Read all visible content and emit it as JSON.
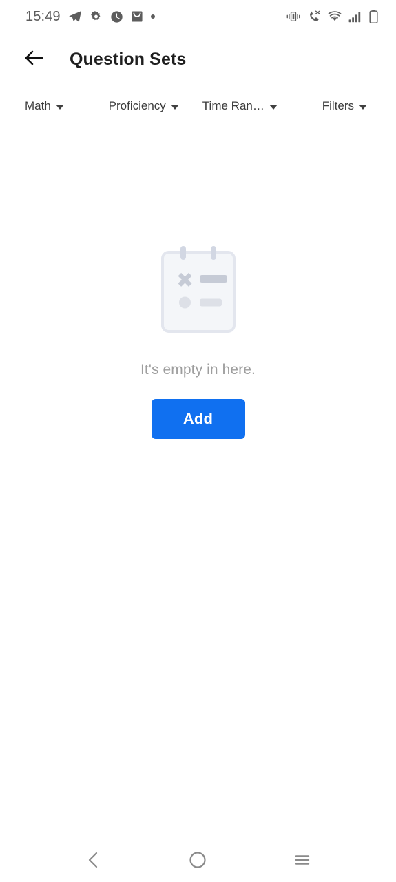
{
  "statusbar": {
    "time": "15:49",
    "left_icons": [
      {
        "name": "telegram-icon"
      },
      {
        "name": "gear-icon"
      },
      {
        "name": "clock-icon"
      },
      {
        "name": "inbox-icon"
      },
      {
        "name": "dot-indicator-icon"
      }
    ],
    "right_icons": [
      {
        "name": "vibrate-mode-icon"
      },
      {
        "name": "missed-call-icon"
      },
      {
        "name": "wifi-icon"
      },
      {
        "name": "cellular-signal-icon"
      },
      {
        "name": "battery-icon"
      }
    ],
    "colors": {
      "icon": "#5d5d5d",
      "text": "#5b5b5b"
    }
  },
  "appbar": {
    "back_icon": "arrow-left-icon",
    "title": "Question Sets",
    "title_color": "#1f1f1f"
  },
  "filters": [
    {
      "id": "subject",
      "label": "Math",
      "caret": "chevron-down-icon"
    },
    {
      "id": "proficiency",
      "label": "Proficiency",
      "caret": "chevron-down-icon"
    },
    {
      "id": "time-range",
      "label": "Time Ran…",
      "caret": "chevron-down-icon"
    },
    {
      "id": "filters",
      "label": "Filters",
      "caret": "chevron-down-icon"
    }
  ],
  "empty_state": {
    "illustration": "empty-clipboard-illustration",
    "message": "It's empty in here.",
    "message_color": "#9e9e9e",
    "action_label": "Add",
    "action_color": "#1070f0",
    "action_text_color": "#ffffff",
    "illustration_colors": {
      "card_fill": "#f5f6f8",
      "card_border": "#e2e5ed",
      "ring": "#d3d8e4",
      "mark_dark": "#c6cbd6",
      "mark_light": "#dcdfe6"
    }
  },
  "navbar": {
    "buttons": [
      {
        "id": "back",
        "icon": "chevron-left-icon"
      },
      {
        "id": "home",
        "icon": "circle-home-icon"
      },
      {
        "id": "recents",
        "icon": "hamburger-recents-icon"
      }
    ],
    "color": "#8a8a8a"
  }
}
